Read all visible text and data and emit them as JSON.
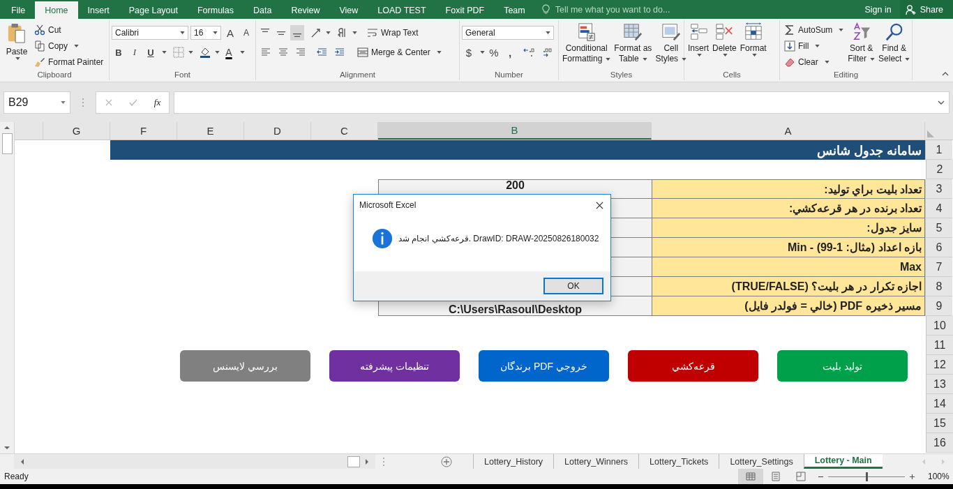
{
  "ribbon_tabs": [
    {
      "label": "File",
      "selected": false
    },
    {
      "label": "Home",
      "selected": true
    },
    {
      "label": "Insert",
      "selected": false
    },
    {
      "label": "Page Layout",
      "selected": false
    },
    {
      "label": "Formulas",
      "selected": false
    },
    {
      "label": "Data",
      "selected": false
    },
    {
      "label": "Review",
      "selected": false
    },
    {
      "label": "View",
      "selected": false
    },
    {
      "label": "LOAD TEST",
      "selected": false
    },
    {
      "label": "Foxit PDF",
      "selected": false
    },
    {
      "label": "Team",
      "selected": false
    }
  ],
  "tell_me": {
    "placeholder": "Tell me what you want to do..."
  },
  "account": {
    "sign_in": "Sign in",
    "share": "Share"
  },
  "clipboard": {
    "paste": "Paste",
    "cut": "Cut",
    "copy": "Copy",
    "format_painter": "Format Painter",
    "label": "Clipboard"
  },
  "font": {
    "family": "Calibri",
    "size": "16",
    "grow": "A",
    "shrink": "A",
    "bold": "B",
    "italic": "I",
    "underline": "U",
    "color_letter": "A",
    "label": "Font"
  },
  "alignment": {
    "vertical": [
      {
        "selected": false
      },
      {
        "selected": false
      },
      {
        "selected": true
      }
    ],
    "wrap_text": "Wrap Text",
    "merge_center": "Merge & Center",
    "label": "Alignment"
  },
  "number": {
    "format": "General",
    "currency": "$",
    "percent": "%",
    "comma": ",",
    "label": "Number"
  },
  "styles": {
    "buttons": [
      {
        "lines": [
          "Conditional",
          "Formatting"
        ]
      },
      {
        "lines": [
          "Format as",
          "Table"
        ]
      },
      {
        "lines": [
          "Cell",
          "Styles"
        ]
      }
    ],
    "label": "Styles"
  },
  "cells": {
    "buttons": [
      "Insert",
      "Delete",
      "Format"
    ],
    "label": "Cells"
  },
  "editing": {
    "autosum": "AutoSum",
    "fill": "Fill",
    "clear": "Clear",
    "sort_filter": [
      "Sort &",
      "Filter"
    ],
    "find_select": [
      "Find &",
      "Select"
    ],
    "label": "Editing"
  },
  "formula_bar": {
    "name_box": "B29",
    "fx": "fx"
  },
  "columns": [
    {
      "label": "G",
      "selected": false
    },
    {
      "label": "F",
      "selected": false
    },
    {
      "label": "E",
      "selected": false
    },
    {
      "label": "D",
      "selected": false
    },
    {
      "label": "C",
      "selected": false
    },
    {
      "label": "B",
      "selected": true
    },
    {
      "label": "A",
      "selected": false
    }
  ],
  "row_numbers": [
    "1",
    "2",
    "3",
    "4",
    "5",
    "6",
    "7",
    "8",
    "9",
    "10",
    "11",
    "12",
    "13",
    "14",
    "15",
    "16"
  ],
  "title": "سامانه جدول شانس",
  "fields": [
    {
      "label": "تعداد بليت براي توليد:",
      "value": "200"
    },
    {
      "label": "تعداد برنده در هر قرعه‌کشي:"
    },
    {
      "label": "سايز جدول:"
    },
    {
      "label": "بازه اعداد (مثال: 1-99) - Min"
    },
    {
      "label": "Max"
    },
    {
      "label": "اجازه تکرار در هر بليت؟ (TRUE/FALSE)"
    },
    {
      "label": "مسير ذخيره PDF (خالي = فولدر فايل)",
      "value": "C:\\Users\\Rasoul\\Desktop"
    }
  ],
  "buttons": [
    {
      "label": "توليد بليت",
      "color": "#00a04a"
    },
    {
      "label": "قرعه‌کشي",
      "color": "#c00000"
    },
    {
      "label": "خروجي PDF  برندگان",
      "color": "#0066cc"
    },
    {
      "label": "تنظيمات پيشرفته",
      "color": "#7030a0"
    },
    {
      "label": "بررسي لايسنس",
      "color": "#808080"
    }
  ],
  "dialog": {
    "title": "Microsoft Excel",
    "message": "قرعه‌کشي انجام شد. DrawID: DRAW-20250826180032",
    "ok": "OK"
  },
  "sheet_tabs": [
    {
      "label": "Lottery_History",
      "selected": false
    },
    {
      "label": "Lottery_Winners",
      "selected": false
    },
    {
      "label": "Lottery_Tickets",
      "selected": false
    },
    {
      "label": "Lottery_Settings",
      "selected": false
    },
    {
      "label": "Lottery - Main",
      "selected": true
    }
  ],
  "status_bar": {
    "status": "Ready",
    "zoom_slider": {
      "level": 0.5
    },
    "zoom": "100%"
  }
}
